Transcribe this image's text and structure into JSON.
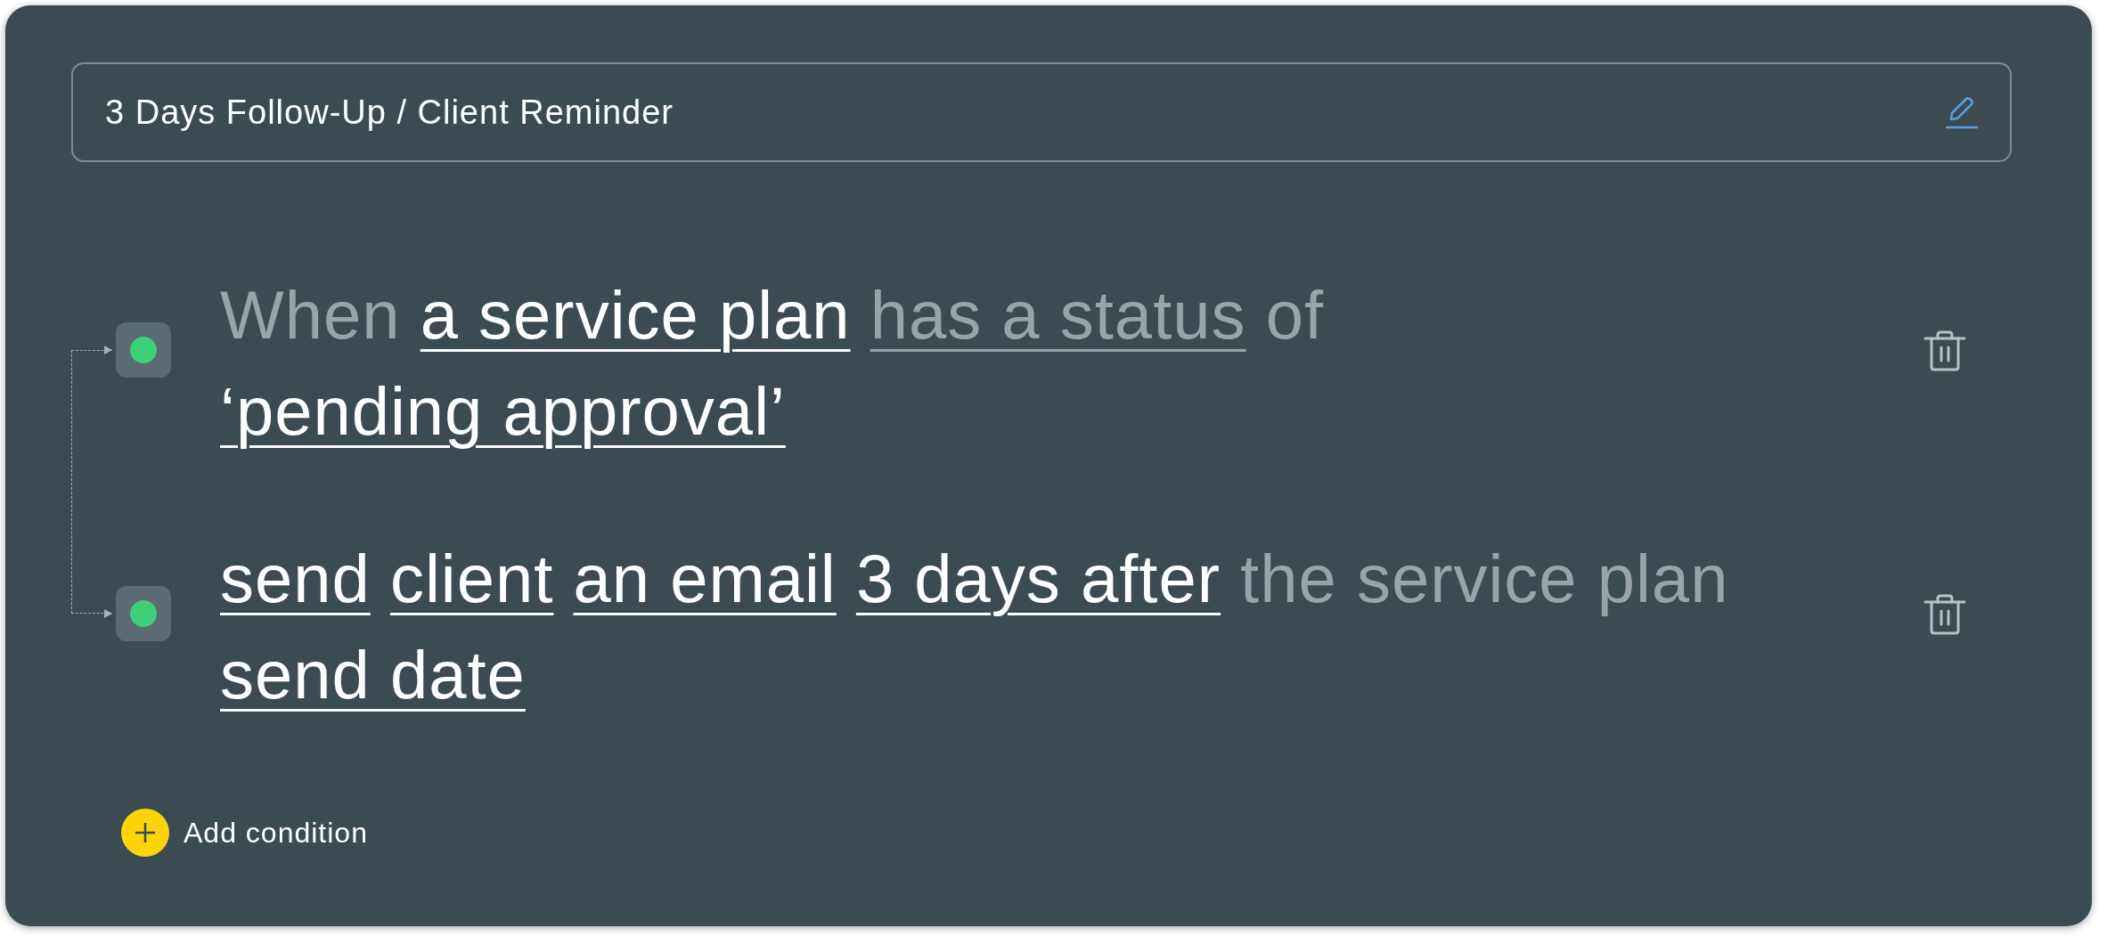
{
  "title_field": {
    "value": "3 Days Follow-Up / Client Reminder"
  },
  "conditions": [
    {
      "parts": [
        {
          "text": "When",
          "kind": "plain"
        },
        {
          "text": "a service plan",
          "kind": "token"
        },
        {
          "text": "has a status",
          "kind": "muted_token"
        },
        {
          "text": "of",
          "kind": "plain"
        },
        {
          "text": "‘pending approval’",
          "kind": "token"
        }
      ]
    },
    {
      "parts": [
        {
          "text": "send",
          "kind": "token"
        },
        {
          "text": "client",
          "kind": "token"
        },
        {
          "text": "an email",
          "kind": "token"
        },
        {
          "text": "3 days after",
          "kind": "token"
        },
        {
          "text": "the service plan",
          "kind": "plain"
        },
        {
          "text": "send date",
          "kind": "token"
        }
      ]
    }
  ],
  "add_button": {
    "label": "Add condition"
  }
}
